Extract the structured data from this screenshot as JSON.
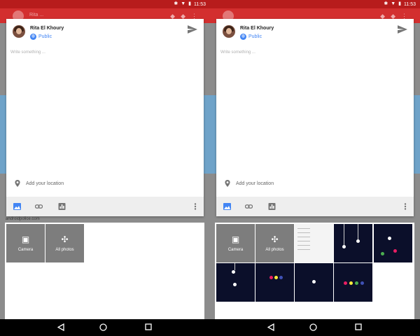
{
  "status_bar": {
    "time": "11:53"
  },
  "post": {
    "author": "Rita El Khoury",
    "audience": "Public",
    "placeholder": "Write something ...",
    "location": "Add your location"
  },
  "picker": {
    "camera_label": "Camera",
    "all_photos_label": "All photos"
  },
  "background": {
    "app_title": "Rita ...",
    "website_text": "androidpolice.com"
  },
  "colors": {
    "accent": "#4285f4",
    "app_bar": "#d32f2f",
    "status_bar": "#b71c1c"
  }
}
